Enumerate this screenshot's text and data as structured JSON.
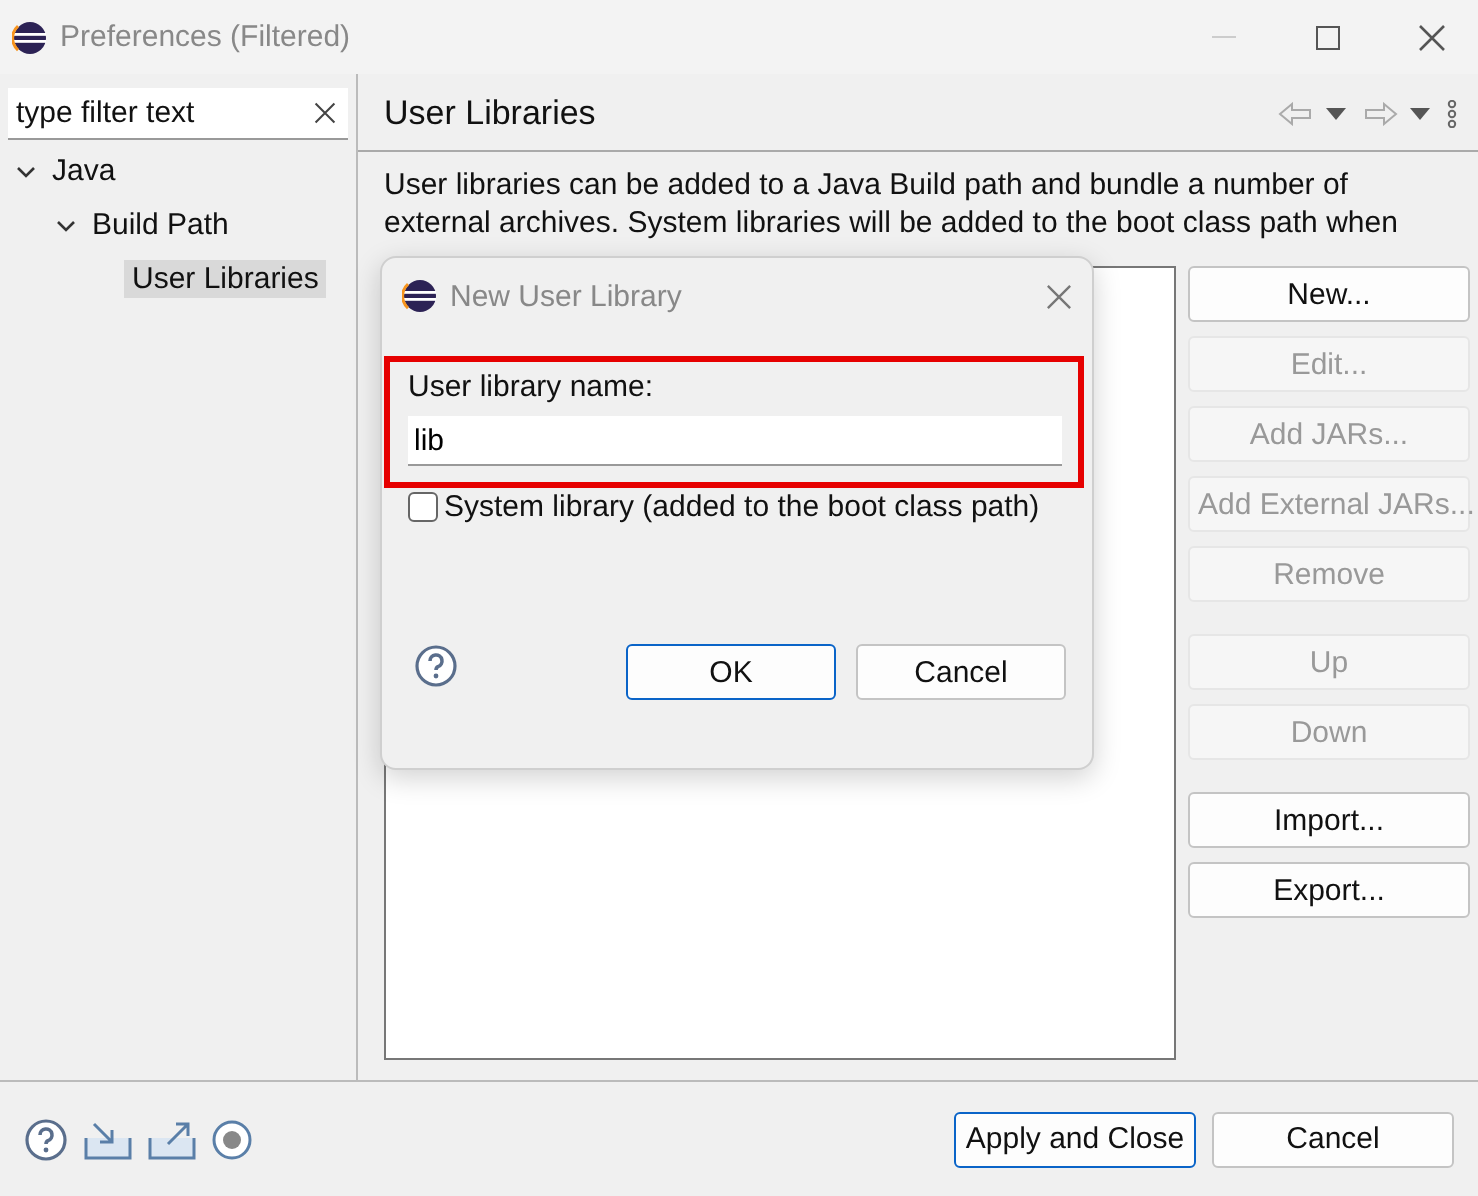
{
  "window": {
    "title": "Preferences (Filtered)"
  },
  "sidebar": {
    "filter": {
      "placeholder": "type filter text"
    },
    "tree": [
      {
        "label": "Java",
        "expanded": true,
        "selected": false,
        "children": [
          {
            "label": "Build Path",
            "expanded": true,
            "selected": false,
            "children": [
              {
                "label": "User Libraries",
                "selected": true
              }
            ]
          }
        ]
      }
    ]
  },
  "page": {
    "title": "User Libraries",
    "description": [
      "User libraries can be added to a Java Build path and bundle a number of",
      "external archives. System libraries will be added to the boot class path when"
    ],
    "button_groups": [
      [
        {
          "label": "New...",
          "disabled": false
        },
        {
          "label": "Edit...",
          "disabled": true
        },
        {
          "label": "Add JARs...",
          "disabled": true
        },
        {
          "label": "Add External JARs...",
          "disabled": true
        },
        {
          "label": "Remove",
          "disabled": true
        }
      ],
      [
        {
          "label": "Up",
          "disabled": true
        },
        {
          "label": "Down",
          "disabled": true
        }
      ],
      [
        {
          "label": "Import...",
          "disabled": false
        },
        {
          "label": "Export...",
          "disabled": false
        }
      ]
    ]
  },
  "dialog": {
    "title": "New User Library",
    "name_label": "User library name:",
    "name_value": "lib",
    "highlighted": true,
    "system_library": {
      "label": "System library (added to the boot class path)",
      "checked": false
    },
    "buttons": [
      {
        "label": "OK",
        "default": true
      },
      {
        "label": "Cancel",
        "default": false
      }
    ]
  },
  "footer": {
    "buttons": [
      {
        "label": "Apply and Close",
        "default": true
      },
      {
        "label": "Cancel",
        "default": false
      }
    ]
  }
}
